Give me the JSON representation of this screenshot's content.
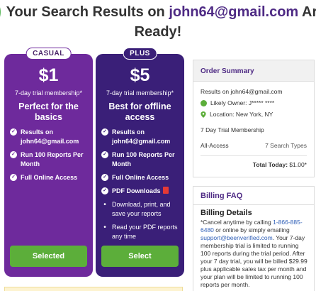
{
  "header": {
    "line1_prefix": "Your Search Results on ",
    "email": "john64@gmail.com",
    "line1_suffix": " Are",
    "line2": "Ready!"
  },
  "plans": [
    {
      "badge": "CASUAL",
      "price": "$1",
      "trial": "7-day trial membership*",
      "best_for": "Perfect for the basics",
      "features": [
        "Results on john64@gmail.com",
        "Run 100 Reports Per Month",
        "Full Online Access"
      ],
      "button": "Selected"
    },
    {
      "badge": "PLUS",
      "price": "$5",
      "trial": "7-day trial membership*",
      "best_for": "Best for offline access",
      "features": [
        "Results on john64@gmail.com",
        "Run 100 Reports Per Month",
        "Full Online Access",
        "PDF Downloads"
      ],
      "bullets": [
        "Download, print, and save your reports",
        "Read your PDF reports any time"
      ],
      "button": "Select"
    }
  ],
  "order_summary": {
    "heading": "Order Summary",
    "results_on": "Results on john64@gmail.com",
    "likely_owner": "Likely Owner: J***** ****",
    "location": "Location: New York, NY",
    "membership": "7 Day Trial Membership",
    "access_label": "All-Access",
    "access_value": "7 Search Types",
    "total_label": "Total Today:",
    "total_value": "$1.00*"
  },
  "faq": {
    "heading": "Billing FAQ",
    "title": "Billing Details",
    "text_before_phone": "*Cancel anytime by calling ",
    "phone": "1-866-885-6480",
    "text_before_email": " or online by simply emailing ",
    "support_email": "support@beenverified.com",
    "text_after": ". Your 7-day membership trial is limited to running 100 reports during the trial period. After your 7 day trial, you will be billed $29.99 plus applicable sales tax per month and your plan will be limited to running 100 reports per month."
  },
  "colors": {
    "casual_card": "#6e2a9c",
    "plus_card": "#3a1f78",
    "select_button": "#5cae3a",
    "brand_purple": "#4e2a84"
  }
}
